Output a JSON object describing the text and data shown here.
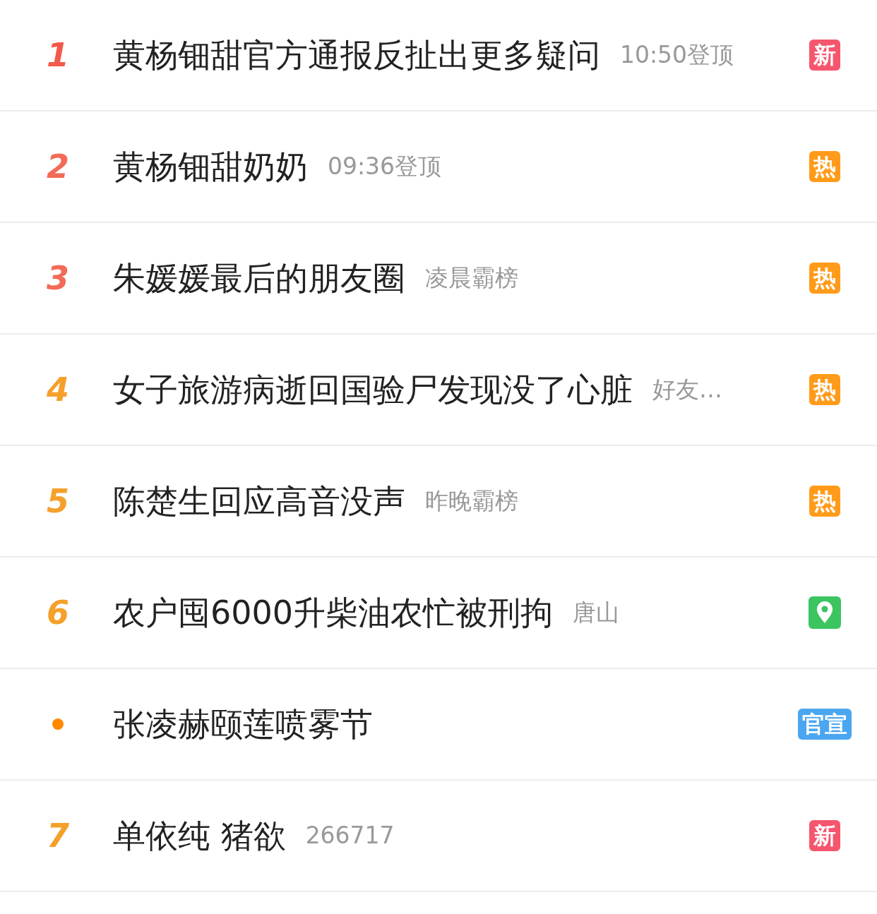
{
  "rows": [
    {
      "rank": {
        "kind": "number",
        "text": "1",
        "color": "#f25a4a"
      },
      "title": "黄杨钿甜官方通报反扯出更多疑问",
      "meta": "10:50登顶",
      "badge": {
        "kind": "text",
        "label": "新",
        "color": "#f5566e"
      }
    },
    {
      "rank": {
        "kind": "number",
        "text": "2",
        "color": "#f26b58"
      },
      "title": "黄杨钿甜奶奶",
      "meta": "09:36登顶",
      "badge": {
        "kind": "text",
        "label": "热",
        "color": "#ff9b1a"
      }
    },
    {
      "rank": {
        "kind": "number",
        "text": "3",
        "color": "#f26b58"
      },
      "title": "朱媛媛最后的朋友圈",
      "meta": "凌晨霸榜",
      "badge": {
        "kind": "text",
        "label": "热",
        "color": "#ff9b1a"
      }
    },
    {
      "rank": {
        "kind": "number",
        "text": "4",
        "color": "#f5a02a"
      },
      "title": "女子旅游病逝回国验尸发现没了心脏",
      "meta": "好友…",
      "badge": {
        "kind": "text",
        "label": "热",
        "color": "#ff9b1a"
      }
    },
    {
      "rank": {
        "kind": "number",
        "text": "5",
        "color": "#f5a02a"
      },
      "title": "陈楚生回应高音没声",
      "meta": "昨晚霸榜",
      "badge": {
        "kind": "text",
        "label": "热",
        "color": "#ff9b1a"
      }
    },
    {
      "rank": {
        "kind": "number",
        "text": "6",
        "color": "#f5a02a"
      },
      "title": "农户囤6000升柴油农忙被刑拘",
      "meta": "唐山",
      "badge": {
        "kind": "location",
        "color": "#3cc461"
      }
    },
    {
      "rank": {
        "kind": "dot",
        "color": "#ff8a00"
      },
      "title": "张凌赫颐莲喷雾节",
      "badge": {
        "kind": "text",
        "label": "官宣",
        "color": "#4aa6f0"
      }
    },
    {
      "rank": {
        "kind": "number",
        "text": "7",
        "color": "#f5a02a"
      },
      "title": "单依纯 猪欲",
      "meta": "266717",
      "badge": {
        "kind": "text",
        "label": "新",
        "color": "#f5566e"
      }
    }
  ]
}
